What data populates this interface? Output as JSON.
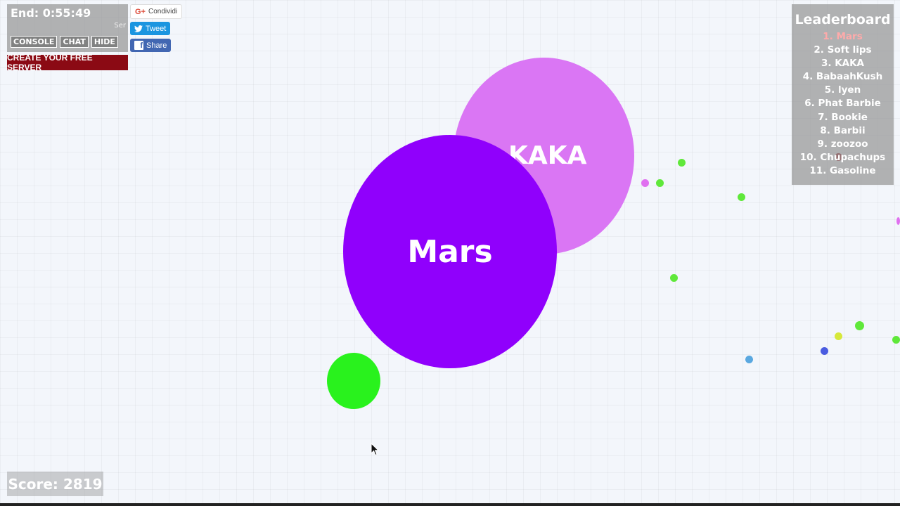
{
  "hud": {
    "timer": "End: 0:55:49",
    "server_text": "Ser",
    "buttons": [
      "CONSOLE",
      "CHAT",
      "HIDE"
    ],
    "create_server": "CREATE YOUR FREE SERVER"
  },
  "social": {
    "google": "Condividi",
    "tweet": "Tweet",
    "share": "Share"
  },
  "leaderboard": {
    "title": "Leaderboard",
    "entries": [
      "1. Mars",
      "2. Soft lips",
      "3. KAKA",
      "4. BabaahKush",
      "5. lyen",
      "6. Phat Barbie",
      "7. Bookie",
      "8. Barbii",
      "9. zoozoo",
      "10. Chupachups",
      "11. Gasoline"
    ]
  },
  "score": "Score: 2819",
  "cells": {
    "kaka": {
      "name": "KAKA",
      "color": "#da76f4"
    },
    "mars": {
      "name": "Mars",
      "color": "#9000fc"
    },
    "green_blob": {
      "color": "#29f21d"
    }
  },
  "colors": {
    "pellet_green": "#5fe83a",
    "pellet_pink": "#e070f0",
    "pellet_blue": "#4a5ce0",
    "pellet_lightblue": "#5aa8e0",
    "pellet_yellow": "#d6e83a",
    "pellet_maroon": "#8b0a14"
  }
}
